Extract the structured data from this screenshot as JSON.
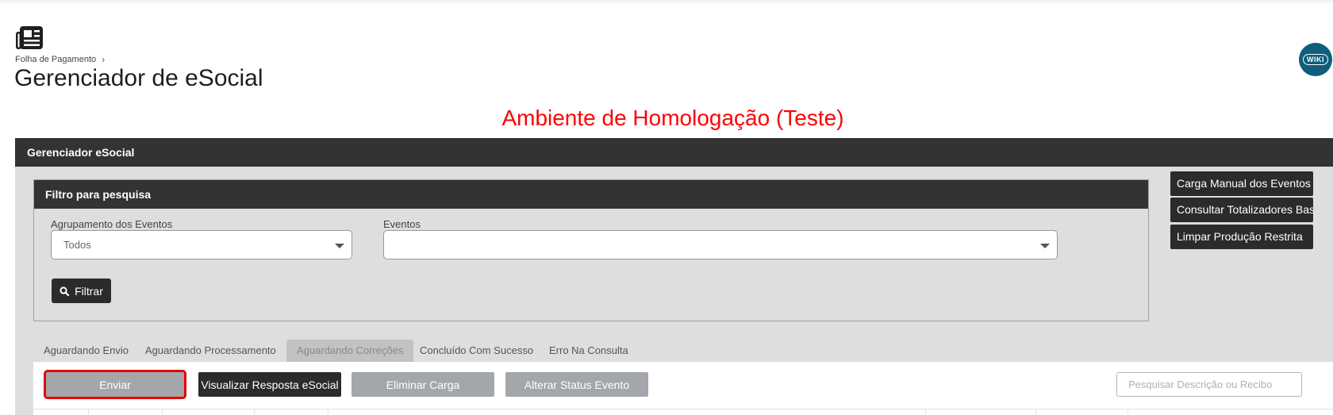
{
  "header": {
    "breadcrumb": "Folha de Pagamento",
    "breadcrumb_chevron": "›",
    "title": "Gerenciador de eSocial",
    "wiki_label": "WIKI",
    "app_icon": "newspaper-icon"
  },
  "environment_banner": "Ambiente de Homologação (Teste)",
  "main_panel": {
    "title": "Gerenciador eSocial"
  },
  "filter": {
    "title": "Filtro para pesquisa",
    "group_label": "Agrupamento dos Eventos",
    "group_value": "Todos",
    "events_label": "Eventos",
    "events_value": "",
    "filter_button": "Filtrar",
    "filter_icon": "search-icon"
  },
  "side_actions": [
    {
      "label": "Carga Manual dos Eventos"
    },
    {
      "label": "Consultar Totalizadores Base"
    },
    {
      "label": "Limpar Produção Restrita"
    }
  ],
  "tabs": [
    {
      "label": "Aguardando Envio",
      "active": false
    },
    {
      "label": "Aguardando Processamento",
      "active": false
    },
    {
      "label": "Aguardando Correções",
      "active": true
    },
    {
      "label": "Concluído Com Sucesso",
      "active": false
    },
    {
      "label": "Erro Na Consulta",
      "active": false
    }
  ],
  "actions": {
    "send": "Enviar",
    "view_response": "Visualizar Resposta eSocial",
    "delete_load": "Eliminar Carga",
    "change_status": "Alterar Status Evento",
    "search_placeholder": "Pesquisar Descrição ou Recibo"
  },
  "colors": {
    "dark_header": "#333333",
    "banner_red": "#ff0000",
    "highlight_red": "#e60000",
    "disabled_grey": "#a3a6aa",
    "wiki_teal": "#0e5e7c"
  }
}
